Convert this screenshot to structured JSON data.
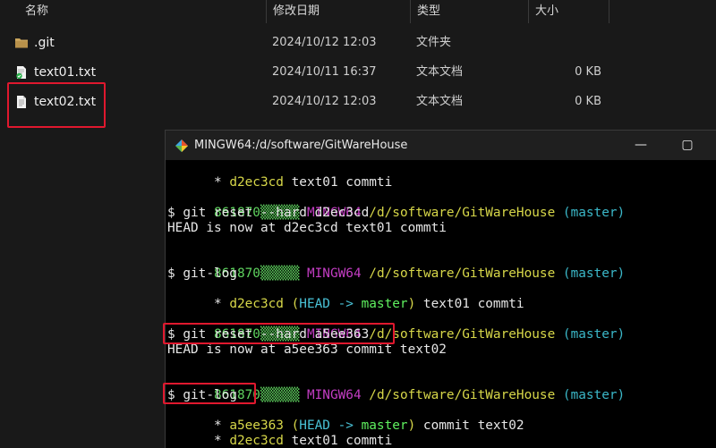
{
  "explorer": {
    "columns": {
      "name": "名称",
      "modified": "修改日期",
      "type": "类型",
      "size": "大小"
    },
    "files": [
      {
        "name": ".git",
        "modified": "2024/10/12 12:03",
        "type": "文件夹",
        "size": "",
        "icon": "folder-icon"
      },
      {
        "name": "text01.txt",
        "modified": "2024/10/11 16:37",
        "type": "文本文档",
        "size": "0 KB",
        "icon": "text-file-synced-icon"
      },
      {
        "name": "text02.txt",
        "modified": "2024/10/12 12:03",
        "type": "文本文档",
        "size": "0 KB",
        "icon": "text-file-icon"
      }
    ]
  },
  "terminal": {
    "title": "MINGW64:/d/software/GitWareHouse",
    "minimize": "—",
    "maximize": "▢",
    "lines": {
      "l1_star": "* ",
      "l1_hash": "d2ec3cd",
      "l1_msg": " text01 commti",
      "p1_user": "861870▒▒▒▒▒",
      "p1_env": "MINGW64",
      "p1_path": "/d/software/GitWareHouse",
      "p1_branch": "(master)",
      "cmd1": "$ git reset --hard d2ec3cd",
      "out1": "HEAD is now at d2ec3cd text01 commti",
      "p2_user": "861870▒▒▒▒▒",
      "p2_env": "MINGW64",
      "p2_path": "/d/software/GitWareHouse",
      "p2_branch": "(master)",
      "cmd2": "$ git-log",
      "l2_star": "* ",
      "l2_hash": "d2ec3cd",
      "l2_open": " (",
      "l2_head": "HEAD -> ",
      "l2_master": "master",
      "l2_close": ")",
      "l2_msg": " text01 commti",
      "p3_user": "861870▒▒▒▒▒",
      "p3_env": "MINGW64",
      "p3_path": "/d/software/GitWareHouse",
      "p3_branch": "(master)",
      "cmd3": "$ git reset --hard a5ee363",
      "out3": "HEAD is now at a5ee363 commit text02",
      "p4_user": "861870▒▒▒▒▒",
      "p4_env": "MINGW64",
      "p4_path": "/d/software/GitWareHouse",
      "p4_branch": "(master)",
      "cmd4": "$ git-log",
      "l4_star": "* ",
      "l4_hash": "a5ee363",
      "l4_open": " (",
      "l4_head": "HEAD -> ",
      "l4_master": "master",
      "l4_close": ")",
      "l4_msg": " commit text02",
      "l5_star": "* ",
      "l5_hash": "d2ec3cd",
      "l5_msg": " text01 commti"
    }
  },
  "colors": {
    "highlight": "#e0182e",
    "prompt_user": "#5fd35f",
    "prompt_env": "#c33dc3",
    "prompt_path": "#d7d749",
    "prompt_branch": "#3bb8c9"
  }
}
